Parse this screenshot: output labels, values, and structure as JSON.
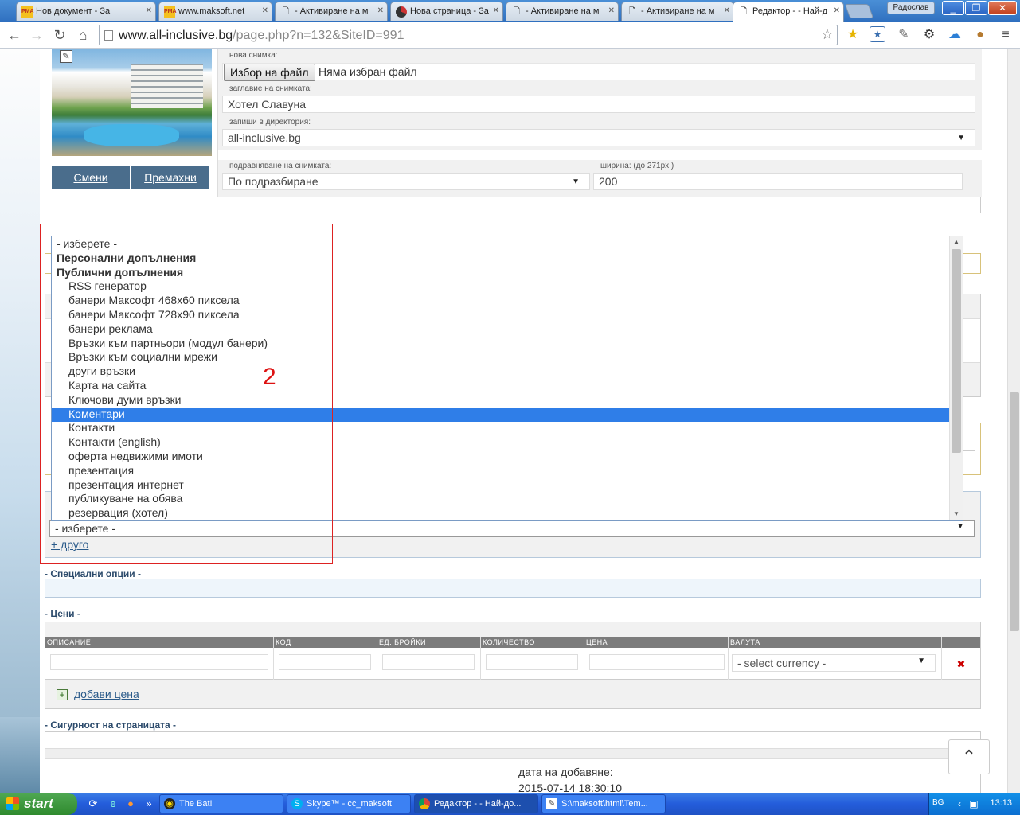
{
  "browser": {
    "tabs": [
      {
        "label": "Нов документ - За",
        "icon": "PMA"
      },
      {
        "label": "www.maksoft.net",
        "icon": "PMA"
      },
      {
        "label": "- Активиране на м",
        "icon": "doc"
      },
      {
        "label": "Нова страница - За",
        "icon": "pie"
      },
      {
        "label": "- Активиране на м",
        "icon": "doc"
      },
      {
        "label": "- Активиране на м",
        "icon": "doc"
      },
      {
        "label": "Редактор - - Най-д",
        "icon": "doc"
      }
    ],
    "user": "Радослав",
    "url_host": "www.all-inclusive.bg",
    "url_path": "/page.php?n=132&SiteID=991"
  },
  "photo_section": {
    "change_label": "Смени",
    "remove_label": "Премахни",
    "new_photo_label": "нова снимка:",
    "choose_file_btn": "Избор на файл",
    "no_file_text": "Няма избран файл",
    "title_label": "заглавие на снимката:",
    "title_value": "Хотел Славуна",
    "dir_label": "запиши в директория:",
    "dir_value": "all-inclusive.bg",
    "align_label": "подравняване на снимката:",
    "align_value": "По подразбиране",
    "width_label": "ширина: (до 271px.)",
    "width_value": "200"
  },
  "addon_list": {
    "options": [
      {
        "label": "- изберете -",
        "kind": "plain"
      },
      {
        "label": "Персонални допълнения",
        "kind": "group"
      },
      {
        "label": "Публични допълнения",
        "kind": "group"
      },
      {
        "label": "RSS генератор",
        "kind": "item"
      },
      {
        "label": "банери Максофт 468x60 пиксела",
        "kind": "item"
      },
      {
        "label": "банери Максофт 728x90 пиксела",
        "kind": "item"
      },
      {
        "label": "банери реклама",
        "kind": "item"
      },
      {
        "label": "Връзки към партньори (модул банери)",
        "kind": "item"
      },
      {
        "label": "Връзки към социални мрежи",
        "kind": "item"
      },
      {
        "label": "други връзки",
        "kind": "item"
      },
      {
        "label": "Карта на сайта",
        "kind": "item"
      },
      {
        "label": "Ключови думи връзки",
        "kind": "item"
      },
      {
        "label": "Коментари",
        "kind": "item",
        "selected": true
      },
      {
        "label": "Контакти",
        "kind": "item"
      },
      {
        "label": "Контакти (english)",
        "kind": "item"
      },
      {
        "label": "оферта недвижими имоти",
        "kind": "item"
      },
      {
        "label": "презентация",
        "kind": "item"
      },
      {
        "label": "презентация интернет",
        "kind": "item"
      },
      {
        "label": "публикуване на обява",
        "kind": "item"
      },
      {
        "label": "резервация (хотел)",
        "kind": "item"
      }
    ],
    "select_value": "- изберете -",
    "other_link": "+ друго",
    "annotation": "2"
  },
  "special": {
    "title": "- Специални опции -"
  },
  "prices": {
    "title": "- Цени -",
    "headers": [
      "ОПИСАНИЕ",
      "КОД",
      "ЕД. БРОЙКИ",
      "КОЛИЧЕСТВО",
      "ЦЕНА",
      "ВАЛУТА"
    ],
    "currency_placeholder": "- select currency -",
    "add_price": "добави цена"
  },
  "security": {
    "title": "- Сигурност на страницата -",
    "date_label": "дата на добавяне:",
    "date_value": "2015-07-14 18:30:10"
  },
  "taskbar": {
    "start": "start",
    "tasks": [
      {
        "label": "The Bat!",
        "icon": "bat"
      },
      {
        "label": "Skype™ - cc_maksoft",
        "icon": "skype"
      },
      {
        "label": "Редактор - - Най-до...",
        "icon": "chrome",
        "active": true
      },
      {
        "label": "S:\\maksoft\\html\\Tem...",
        "icon": "notepad"
      }
    ],
    "lang": "BG",
    "clock": "13:13"
  },
  "colors": {
    "selection": "#2f7ee8",
    "annotation_red": "#d22",
    "header_gray": "#7c7c7c",
    "link": "#2a5a8a"
  }
}
